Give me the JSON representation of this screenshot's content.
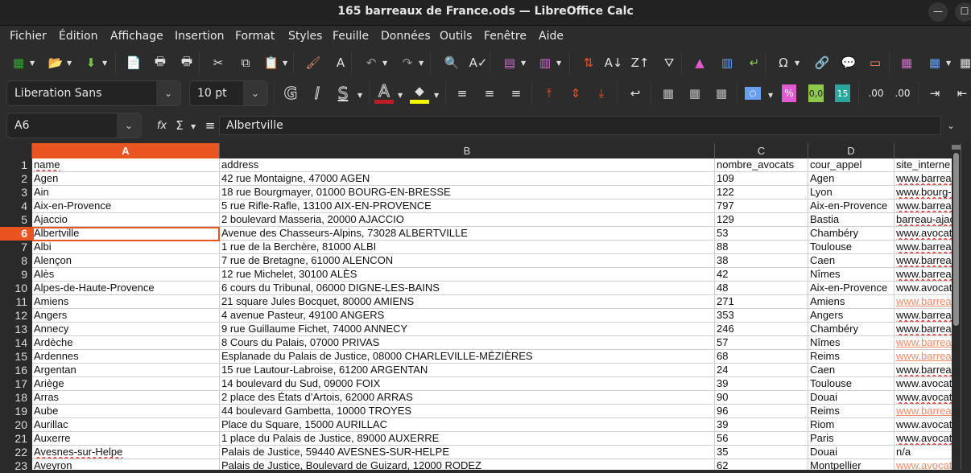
{
  "window": {
    "title": "165 barreaux de France.ods — LibreOffice Calc",
    "minimize_glyph": "—",
    "maximize_glyph": "☐"
  },
  "menu": [
    "Fichier",
    "Édition",
    "Affichage",
    "Insertion",
    "Format",
    "Styles",
    "Feuille",
    "Données",
    "Outils",
    "Fenêtre",
    "Aide"
  ],
  "toolbar_standard": [
    {
      "name": "new-spreadsheet-icon",
      "glyph": "▦",
      "color": "#3aa23a"
    },
    {
      "name": "open-icon",
      "glyph": "📂",
      "color": "#bbbbbb"
    },
    {
      "name": "save-icon",
      "glyph": "⬇",
      "color": "#7cc242"
    },
    {
      "name": "export-pdf-icon",
      "glyph": "📄",
      "color": "#e0e0e0"
    },
    {
      "name": "print-icon",
      "glyph": "🖶",
      "color": "#e0e0e0"
    },
    {
      "name": "print-preview-icon",
      "glyph": "🖶",
      "color": "#e0e0e0"
    },
    {
      "name": "cut-icon",
      "glyph": "✂",
      "color": "#e0e0e0"
    },
    {
      "name": "copy-icon",
      "glyph": "⧉",
      "color": "#e0e0e0"
    },
    {
      "name": "paste-icon",
      "glyph": "📋",
      "color": "#e0e0e0"
    },
    {
      "name": "clone-formatting-icon",
      "glyph": "🖌",
      "color": "#f08c6c"
    },
    {
      "name": "clear-formatting-icon",
      "glyph": "A",
      "color": "#e0e0e0"
    },
    {
      "name": "undo-icon",
      "glyph": "↶",
      "color": "#9a9a9a"
    },
    {
      "name": "redo-icon",
      "glyph": "↷",
      "color": "#9a9a9a"
    },
    {
      "name": "find-replace-icon",
      "glyph": "🔍",
      "color": "#e0e0e0"
    },
    {
      "name": "spellcheck-icon",
      "glyph": "A✓",
      "color": "#e0e0e0"
    },
    {
      "name": "row-icon",
      "glyph": "▤",
      "color": "#d070d0"
    },
    {
      "name": "column-icon",
      "glyph": "▥",
      "color": "#d070d0"
    },
    {
      "name": "sort-icon",
      "glyph": "⇅",
      "color": "#e95420"
    },
    {
      "name": "sort-ascending-icon",
      "glyph": "A↓",
      "color": "#e0e0e0"
    },
    {
      "name": "sort-descending-icon",
      "glyph": "Z↑",
      "color": "#e0e0e0"
    },
    {
      "name": "autofilter-icon",
      "glyph": "⛛",
      "color": "#e0e0e0"
    },
    {
      "name": "insert-image-icon",
      "glyph": "▲",
      "color": "#e05ad0"
    },
    {
      "name": "insert-chart-icon",
      "glyph": "▥",
      "color": "#6a9ef0"
    },
    {
      "name": "pivot-table-icon",
      "glyph": "↵",
      "color": "#8cc84b"
    },
    {
      "name": "special-character-icon",
      "glyph": "Ω",
      "color": "#e0e0e0"
    },
    {
      "name": "hyperlink-icon",
      "glyph": "🔗",
      "color": "#e0e0e0"
    },
    {
      "name": "comment-icon",
      "glyph": "💬",
      "color": "#f08c6c"
    },
    {
      "name": "header-footer-icon",
      "glyph": "▭",
      "color": "#f08c6c"
    },
    {
      "name": "print-range-icon",
      "glyph": "▦",
      "color": "#d070d0"
    },
    {
      "name": "freeze-rows-columns-icon",
      "glyph": "▦",
      "color": "#6a9ef0"
    },
    {
      "name": "split-window-icon",
      "glyph": "▦",
      "color": "#e0e0e0"
    }
  ],
  "toolbar_format": {
    "font_name": "Liberation Sans",
    "font_size": "10 pt",
    "bold_glyph": "G",
    "italic_glyph": "I",
    "underline_glyph": "S",
    "font_color_glyph": "A",
    "font_color": "#c01c28",
    "highlight_color": "#f5f500",
    "number_format_percent": "%",
    "number_format_decimal": "0,0",
    "number_format_date": "15"
  },
  "formula_bar": {
    "name_box": "A6",
    "function_wizard_glyph": "fx",
    "sum_glyph": "Σ",
    "formula_glyph": "≡",
    "content": "Albertville"
  },
  "sheet": {
    "columns": [
      "A",
      "B",
      "C",
      "D",
      ""
    ],
    "selected_column": "A",
    "selected_row": 6,
    "rows": [
      {
        "n": "1",
        "a": "name",
        "b": "address",
        "c": "nombre_avocats",
        "d": "cour_appel",
        "e": "site_interne",
        "e_link": false
      },
      {
        "n": "2",
        "a": "Agen",
        "b": "42 rue Montaigne, 47000 AGEN",
        "c": "109",
        "d": "Agen",
        "e": "www.barreau",
        "e_link": false
      },
      {
        "n": "3",
        "a": "Ain",
        "b": "18 rue Bourgmayer, 01000 BOURG-EN-BRESSE",
        "c": "122",
        "d": "Lyon",
        "e": "www.bourg-",
        "e_link": false
      },
      {
        "n": "4",
        "a": "Aix-en-Provence",
        "b": "5 rue Rifle-Rafle, 13100 AIX-EN-PROVENCE",
        "c": "797",
        "d": "Aix-en-Provence",
        "e": "www.barreau",
        "e_link": false
      },
      {
        "n": "5",
        "a": "Ajaccio",
        "b": "2 boulevard Masseria, 20000 AJACCIO",
        "c": "129",
        "d": "Bastia",
        "e": "barreau-ajac",
        "e_link": false
      },
      {
        "n": "6",
        "a": "Albertville",
        "b": "Avenue des Chasseurs-Alpins, 73028 ALBERTVILLE",
        "c": "53",
        "d": "Chambéry",
        "e": "www.avocat",
        "e_link": false
      },
      {
        "n": "7",
        "a": "Albi",
        "b": "1 rue de la Berchère, 81000 ALBI",
        "c": "88",
        "d": "Toulouse",
        "e": "www.barreau",
        "e_link": false
      },
      {
        "n": "8",
        "a": "Alençon",
        "b": "7 rue de Bretagne, 61000 ALENCON",
        "c": "38",
        "d": "Caen",
        "e": "www.barreau",
        "e_link": false
      },
      {
        "n": "9",
        "a": "Alès",
        "b": "12 rue Michelet, 30100 ALÈS",
        "c": "42",
        "d": "Nîmes",
        "e": "www.barreau",
        "e_link": false
      },
      {
        "n": "10",
        "a": "Alpes-de-Haute-Provence",
        "b": "6 cours du Tribunal, 06000 DIGNE-LES-BAINS",
        "c": "48",
        "d": "Aix-en-Provence",
        "e": "www.avocat",
        "e_link": false
      },
      {
        "n": "11",
        "a": "Amiens",
        "b": "21 square Jules Bocquet, 80000 AMIENS",
        "c": "271",
        "d": "Amiens",
        "e": "www.barreau",
        "e_link": true
      },
      {
        "n": "12",
        "a": "Angers",
        "b": "4 avenue Pasteur, 49100 ANGERS",
        "c": "353",
        "d": "Angers",
        "e": "www.barreau",
        "e_link": false
      },
      {
        "n": "13",
        "a": "Annecy",
        "b": "9 rue Guillaume Fichet, 74000 ANNECY",
        "c": "246",
        "d": "Chambéry",
        "e": "www.barreau",
        "e_link": false
      },
      {
        "n": "14",
        "a": "Ardèche",
        "b": "8 Cours du Palais, 07000 PRIVAS",
        "c": "57",
        "d": "Nîmes",
        "e": "www.barreau",
        "e_link": true
      },
      {
        "n": "15",
        "a": "Ardennes",
        "b": "Esplanade du Palais de Justice, 08000 CHARLEVILLE-MÉZIÈRES",
        "c": "68",
        "d": "Reims",
        "e": "www.barreau",
        "e_link": true
      },
      {
        "n": "16",
        "a": "Argentan",
        "b": "15 rue Lautour-Labroise, 61200 ARGENTAN",
        "c": "24",
        "d": "Caen",
        "e": "www.barreau",
        "e_link": false
      },
      {
        "n": "17",
        "a": "Ariège",
        "b": "14 boulevard du Sud, 09000 FOIX",
        "c": "39",
        "d": "Toulouse",
        "e": "www.avocat",
        "e_link": false
      },
      {
        "n": "18",
        "a": "Arras",
        "b": "2 place des États d’Artois, 62000 ARRAS",
        "c": "90",
        "d": "Douai",
        "e": "www.avocat",
        "e_link": false
      },
      {
        "n": "19",
        "a": "Aube",
        "b": "44 boulevard Gambetta, 10000 TROYES",
        "c": "96",
        "d": "Reims",
        "e": "www.barreau",
        "e_link": true
      },
      {
        "n": "20",
        "a": "Aurillac",
        "b": "Place du Square, 15000 AURILLAC",
        "c": "39",
        "d": "Riom",
        "e": "www.avocat",
        "e_link": false
      },
      {
        "n": "21",
        "a": "Auxerre",
        "b": "1 place du Palais de Justice, 89000 AUXERRE",
        "c": "56",
        "d": "Paris",
        "e": "www.avocat",
        "e_link": false
      },
      {
        "n": "22",
        "a": "Avesnes-sur-Helpe",
        "b": "Palais de Justice, 59440 AVESNES-SUR-HELPE",
        "c": "35",
        "d": "Douai",
        "e": "n/a",
        "e_link": false
      },
      {
        "n": "23",
        "a": "Aveyron",
        "b": "Palais de Justice, Boulevard de Guizard, 12000 RODEZ",
        "c": "62",
        "d": "Montpellier",
        "e": "www.avocat",
        "e_link": true
      }
    ]
  },
  "colors": {
    "accent": "#e95420",
    "link": "#f08c6c",
    "background": "#2c2c2c"
  }
}
